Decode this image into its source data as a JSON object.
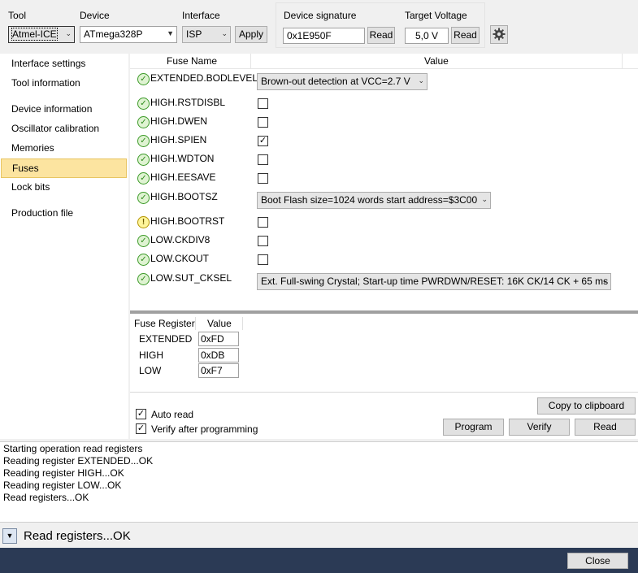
{
  "toolbar": {
    "tool_label": "Tool",
    "tool_value": "Atmel-ICE",
    "device_label": "Device",
    "device_value": "ATmega328P",
    "interface_label": "Interface",
    "interface_value": "ISP",
    "apply_label": "Apply",
    "signature_label": "Device signature",
    "signature_value": "0x1E950F",
    "signature_read_label": "Read",
    "voltage_label": "Target Voltage",
    "voltage_value": "5,0 V",
    "voltage_read_label": "Read",
    "settings_icon": "gear-icon"
  },
  "sidebar": {
    "items": [
      {
        "label": "Interface settings"
      },
      {
        "label": "Tool information"
      },
      {
        "label": "Device information"
      },
      {
        "label": "Oscillator calibration"
      },
      {
        "label": "Memories"
      },
      {
        "label": "Fuses",
        "selected": true
      },
      {
        "label": "Lock bits"
      },
      {
        "label": "Production file"
      }
    ]
  },
  "fuses": {
    "header_name": "Fuse Name",
    "header_value": "Value",
    "rows": [
      {
        "name": "EXTENDED.BODLEVEL",
        "status": "ok",
        "type": "select",
        "value": "Brown-out detection at VCC=2.7 V"
      },
      {
        "name": "HIGH.RSTDISBL",
        "status": "ok",
        "type": "check",
        "checked": false
      },
      {
        "name": "HIGH.DWEN",
        "status": "ok",
        "type": "check",
        "checked": false
      },
      {
        "name": "HIGH.SPIEN",
        "status": "ok",
        "type": "check",
        "checked": true
      },
      {
        "name": "HIGH.WDTON",
        "status": "ok",
        "type": "check",
        "checked": false
      },
      {
        "name": "HIGH.EESAVE",
        "status": "ok",
        "type": "check",
        "checked": false
      },
      {
        "name": "HIGH.BOOTSZ",
        "status": "ok",
        "type": "select",
        "value": "Boot Flash size=1024 words start address=$3C00"
      },
      {
        "name": "HIGH.BOOTRST",
        "status": "warn",
        "type": "check",
        "checked": false
      },
      {
        "name": "LOW.CKDIV8",
        "status": "ok",
        "type": "check",
        "checked": false
      },
      {
        "name": "LOW.CKOUT",
        "status": "ok",
        "type": "check",
        "checked": false
      },
      {
        "name": "LOW.SUT_CKSEL",
        "status": "ok",
        "type": "select",
        "value": "Ext. Full-swing Crystal; Start-up time PWRDWN/RESET: 16K CK/14 CK + 65 ms"
      }
    ]
  },
  "registers": {
    "header_name": "Fuse Register",
    "header_value": "Value",
    "rows": [
      {
        "name": "EXTENDED",
        "value": "0xFD"
      },
      {
        "name": "HIGH",
        "value": "0xDB"
      },
      {
        "name": "LOW",
        "value": "0xF7"
      }
    ]
  },
  "options": {
    "auto_read_label": "Auto read",
    "auto_read_checked": true,
    "verify_label": "Verify after programming",
    "verify_checked": true
  },
  "actions": {
    "copy_label": "Copy to clipboard",
    "program_label": "Program",
    "verify_label": "Verify",
    "read_label": "Read"
  },
  "log": {
    "lines": [
      "Starting operation read registers",
      "Reading register EXTENDED...OK",
      "Reading register HIGH...OK",
      "Reading register LOW...OK",
      "Read registers...OK"
    ]
  },
  "status": {
    "text": "Read registers...OK",
    "expand_icon": "chevron-down-icon"
  },
  "footer": {
    "close_label": "Close"
  },
  "colors": {
    "selected_item": "#fce4a0",
    "ok_icon": "#3d9b29",
    "warn_icon": "#f4e04d",
    "footer_bg": "#2b3a55"
  }
}
